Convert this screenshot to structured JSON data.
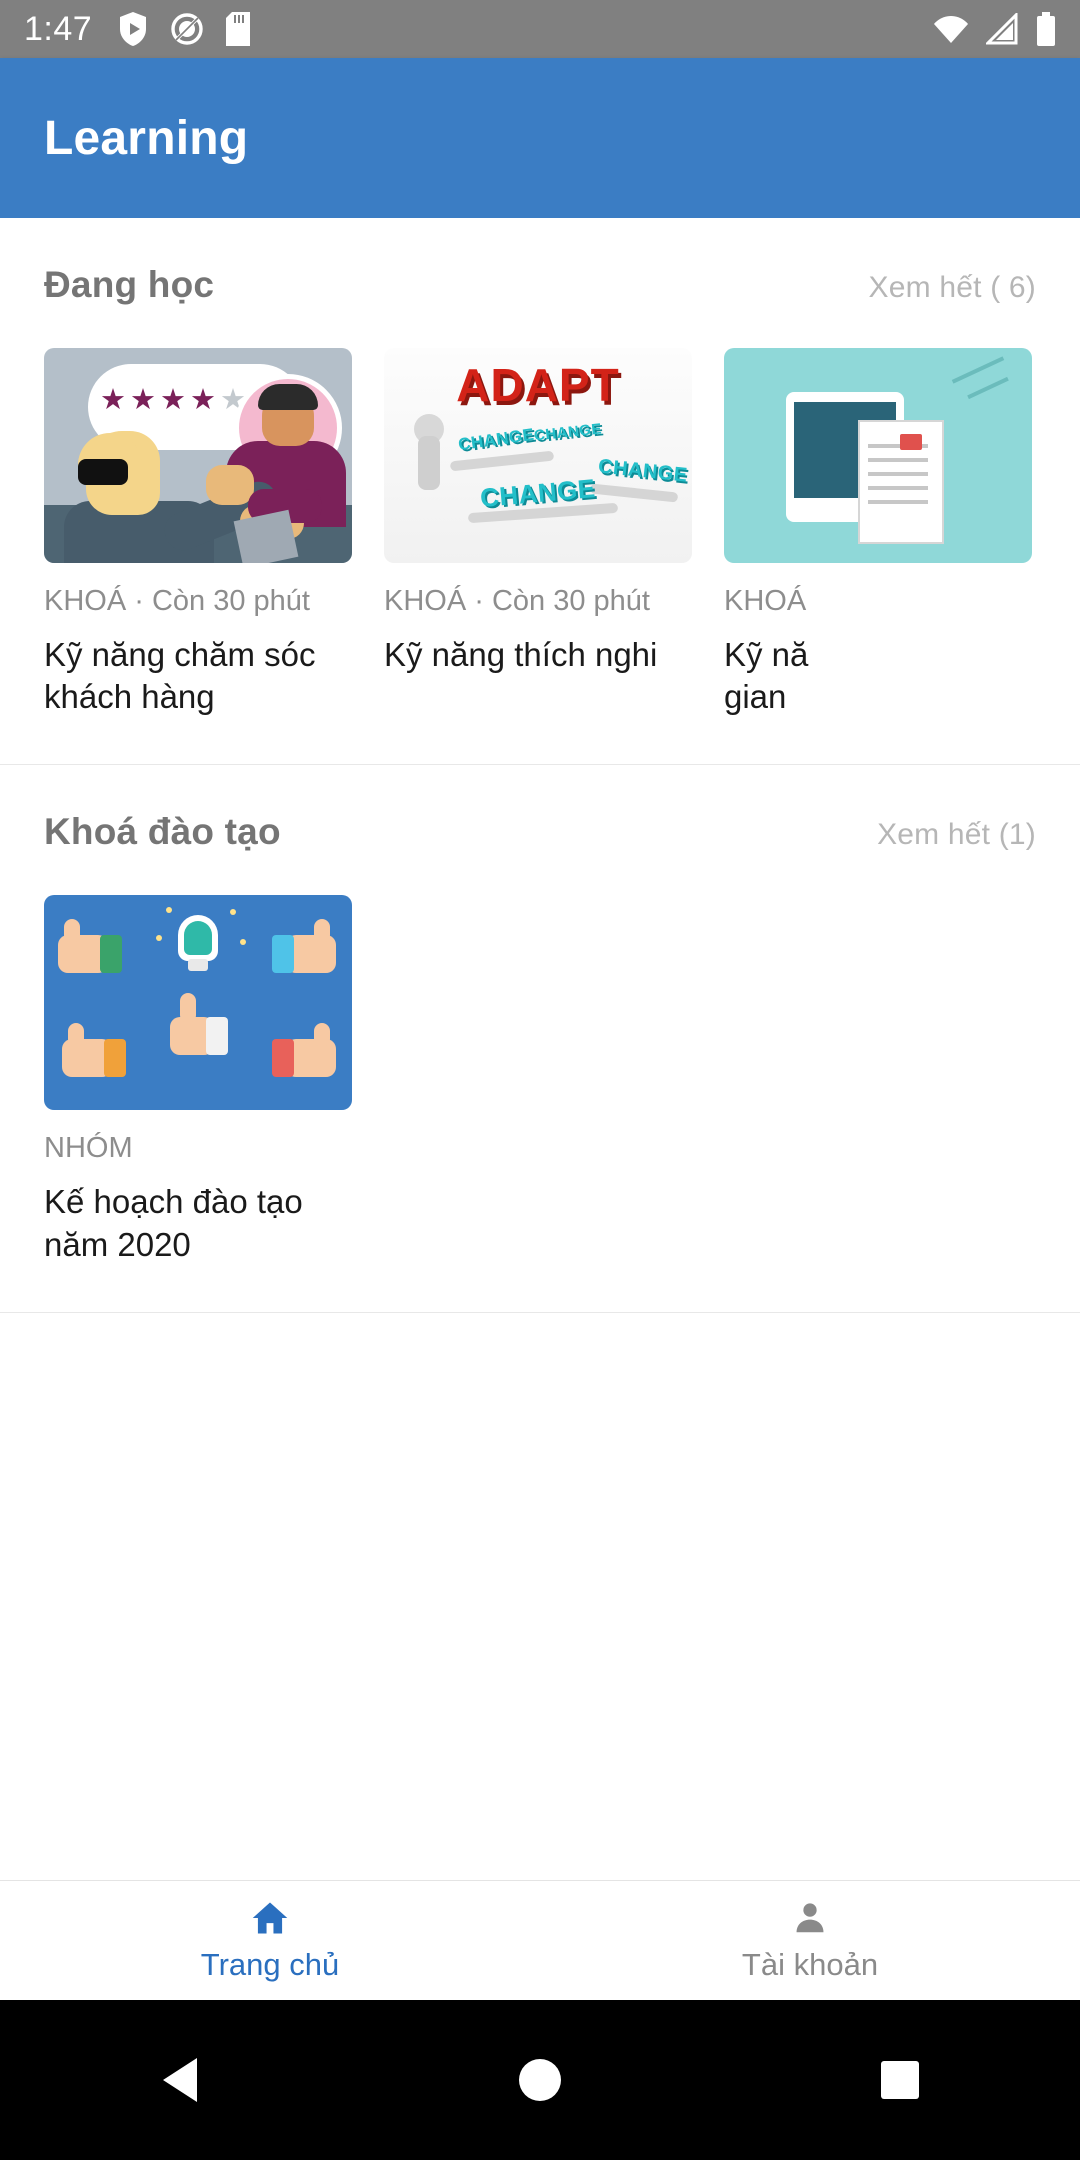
{
  "statusbar": {
    "time": "1:47",
    "icons_left": [
      "play-shield-icon",
      "do-not-disturb-icon",
      "sd-card-icon"
    ],
    "icons_right": [
      "wifi-icon",
      "signal-icon",
      "battery-icon"
    ],
    "background": "#808080"
  },
  "appbar": {
    "title": "Learning",
    "background": "#3b7dc4",
    "text_color": "#ffffff"
  },
  "sections": [
    {
      "title": "Đang học",
      "more_label": "Xem hết ( 6)",
      "cards": [
        {
          "meta": "KHOÁ · Còn 30 phút",
          "title": "Kỹ năng chăm sóc khách hàng",
          "thumb": "customer-service-handshake-rating"
        },
        {
          "meta": "KHOÁ · Còn 30 phút",
          "title": "Kỹ năng thích nghi",
          "thumb": "adapt-change-blocks"
        },
        {
          "meta": "KHOÁ",
          "title": "Kỹ năng quản lý thời gian",
          "title_visible": "Kỹ nă\ngian",
          "thumb": "tablet-document-teal"
        }
      ]
    },
    {
      "title": "Khoá đào tạo",
      "more_label": "Xem hết (1)",
      "cards": [
        {
          "meta": "NHÓM",
          "title": "Kế hoạch đào tạo năm 2020",
          "thumb": "thumbs-up-idea-bulb"
        }
      ]
    }
  ],
  "bottomnav": {
    "items": [
      {
        "label": "Trang chủ",
        "icon": "home-icon",
        "active": true,
        "color": "#2a6fbf"
      },
      {
        "label": "Tài khoản",
        "icon": "person-icon",
        "active": false,
        "color": "#8a8a8a"
      }
    ]
  },
  "androidnav": {
    "back": "back-triangle-icon",
    "home": "home-circle-icon",
    "recents": "recents-square-icon",
    "background": "#000000"
  },
  "text_labels": {
    "card1_meta": "KHOÁ · Còn 30 phút",
    "card2_meta": "KHOÁ · Còn 30 phút",
    "card3_meta": "KHOÁ",
    "card3_title_line1": "Kỹ nă",
    "card3_title_line2": "gian",
    "card4_meta": "NHÓM",
    "card4_title": "Kế hoạch đào tạo năm 2020",
    "adapt_word": "ADAPT",
    "change_word": "CHANGE"
  }
}
